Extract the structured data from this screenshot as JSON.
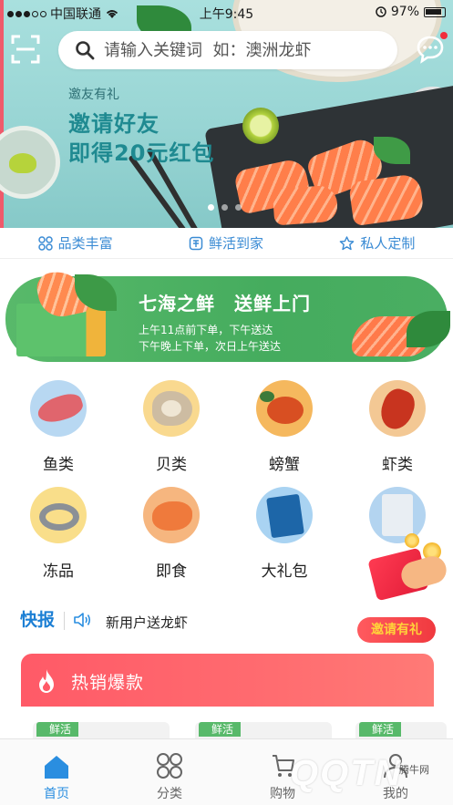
{
  "status_bar": {
    "carrier": "中国联通",
    "time": "上午9:45",
    "battery": "97%"
  },
  "search": {
    "placeholder": "请输入关键词  如：澳洲龙虾"
  },
  "banner": {
    "small_text": "邀友有礼",
    "headline_line1": "邀请好友",
    "headline_line2": "即得20元红包",
    "slide_count": 3,
    "active_slide": 0
  },
  "features": [
    {
      "icon": "grid-icon",
      "label": "品类丰富"
    },
    {
      "icon": "box-icon",
      "label": "鲜活到家"
    },
    {
      "icon": "star-icon",
      "label": "私人定制"
    }
  ],
  "promo": {
    "title": "七海之鲜　送鲜上门",
    "line1": "上午11点前下单，下午送达",
    "line2": "下午晚上下单，次日上午送达"
  },
  "categories": [
    {
      "label": "鱼类",
      "bg": "#b8d8f2"
    },
    {
      "label": "贝类",
      "bg": "#f9d98f"
    },
    {
      "label": "螃蟹",
      "bg": "#f5b85e"
    },
    {
      "label": "虾类",
      "bg": "#f3c894"
    },
    {
      "label": "冻品",
      "bg": "#f9de8a"
    },
    {
      "label": "即食",
      "bg": "#f6b67f"
    },
    {
      "label": "大礼包",
      "bg": "#a9d3f2"
    },
    {
      "label": "",
      "bg": "#b3d4f0"
    }
  ],
  "news": {
    "label": "快报",
    "text": "新用户送龙虾",
    "invite_button": "邀请有礼"
  },
  "hot_sales": {
    "title": "热销爆款",
    "tags": [
      "鲜活",
      "鲜活",
      "鲜活"
    ]
  },
  "tabs": [
    {
      "label": "首页",
      "icon": "home-icon",
      "active": true
    },
    {
      "label": "分类",
      "icon": "category-icon",
      "active": false
    },
    {
      "label": "购物",
      "icon": "cart-icon",
      "active": false
    },
    {
      "label": "我的",
      "icon": "user-icon",
      "active": false
    }
  ],
  "watermark": {
    "brand": "QQTN",
    "site": "腾牛网"
  },
  "colors": {
    "accent": "#2a8ee0",
    "promo_green": "#4aae62",
    "hot_red": "#ff5a67",
    "invite_red": "#f0393f"
  }
}
